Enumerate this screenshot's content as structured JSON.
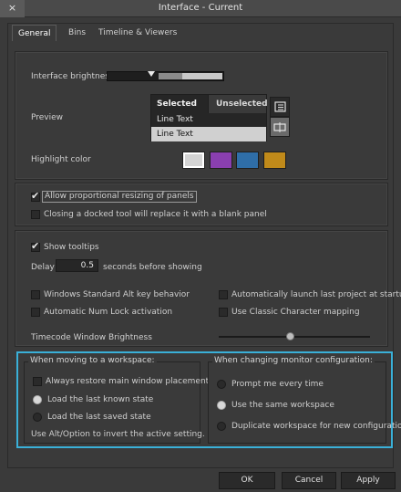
{
  "window": {
    "title": "Interface - Current",
    "close_glyph": "×"
  },
  "tabs": [
    {
      "label": "General",
      "active": true
    },
    {
      "label": "Bins",
      "active": false
    },
    {
      "label": "Timeline & Viewers",
      "active": false
    }
  ],
  "brightness": {
    "label": "Interface brightness",
    "level": 0.35
  },
  "preview": {
    "label": "Preview",
    "selected_tab": "Selected",
    "unselected_tab": "Unselected",
    "row_selected": "Line Text",
    "row_unselected": "Line Text",
    "icon_list": "list-view-icon",
    "icon_frame": "frame-view-icon"
  },
  "highlight": {
    "label": "Highlight color",
    "colors": [
      "#d4d4d4",
      "#8a3fb0",
      "#2f6ea8",
      "#c08a1a"
    ]
  },
  "panels": {
    "resize_label": "Allow proportional resizing of panels",
    "resize_checked": true,
    "docked_label": "Closing a docked tool will replace it with a blank panel",
    "docked_checked": false
  },
  "tooltips": {
    "show_label": "Show tooltips",
    "show_checked": true,
    "delay_label": "Delay",
    "delay_value": "0.5",
    "delay_suffix": "seconds before showing"
  },
  "options": {
    "alt_key": "Windows Standard Alt key behavior",
    "num_lock": "Automatic Num Lock activation",
    "auto_launch": "Automatically launch last project at startup",
    "classic_mapping": "Use Classic Character mapping",
    "timecode_label": "Timecode Window Brightness",
    "timecode_level": 0.45
  },
  "workspace": {
    "title": "When moving to a workspace:",
    "always_restore": "Always restore main window placement",
    "load_known": "Load the last known state",
    "load_saved": "Load the last saved state",
    "hint": "Use Alt/Option to invert the active setting."
  },
  "monitor": {
    "title": "When changing monitor configuration:",
    "prompt": "Prompt me every time",
    "same": "Use the same workspace",
    "duplicate": "Duplicate workspace for new configuration"
  },
  "buttons": {
    "ok": "OK",
    "cancel": "Cancel",
    "apply": "Apply"
  }
}
